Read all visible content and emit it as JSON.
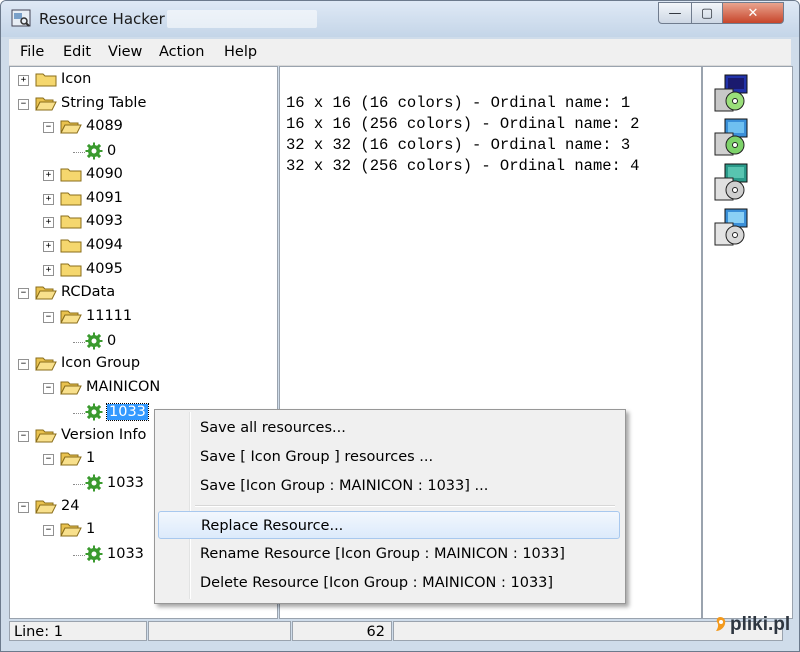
{
  "window": {
    "title": "Resource Hacker",
    "minimize_glyph": "—",
    "maximize_glyph": "▢",
    "close_glyph": "✕"
  },
  "menu": [
    "File",
    "Edit",
    "View",
    "Action",
    "Help"
  ],
  "tree": [
    {
      "label": "Icon",
      "level": 0,
      "expander": "+",
      "icon": "folder-closed-icon"
    },
    {
      "label": "String Table",
      "level": 0,
      "expander": "-",
      "icon": "folder-open-icon"
    },
    {
      "label": "4089",
      "level": 1,
      "expander": "-",
      "icon": "folder-open-icon"
    },
    {
      "label": "0",
      "level": 2,
      "expander": "",
      "icon": "gear-icon"
    },
    {
      "label": "4090",
      "level": 1,
      "expander": "+",
      "icon": "folder-closed-icon"
    },
    {
      "label": "4091",
      "level": 1,
      "expander": "+",
      "icon": "folder-closed-icon"
    },
    {
      "label": "4093",
      "level": 1,
      "expander": "+",
      "icon": "folder-closed-icon"
    },
    {
      "label": "4094",
      "level": 1,
      "expander": "+",
      "icon": "folder-closed-icon"
    },
    {
      "label": "4095",
      "level": 1,
      "expander": "+",
      "icon": "folder-closed-icon"
    },
    {
      "label": "RCData",
      "level": 0,
      "expander": "-",
      "icon": "folder-open-icon"
    },
    {
      "label": "11111",
      "level": 1,
      "expander": "-",
      "icon": "folder-open-icon"
    },
    {
      "label": "0",
      "level": 2,
      "expander": "",
      "icon": "gear-icon"
    },
    {
      "label": "Icon Group",
      "level": 0,
      "expander": "-",
      "icon": "folder-open-icon"
    },
    {
      "label": "MAINICON",
      "level": 1,
      "expander": "-",
      "icon": "folder-open-icon"
    },
    {
      "label": "1033",
      "level": 2,
      "expander": "",
      "icon": "gear-icon",
      "selected": true
    },
    {
      "label": "Version Info",
      "level": 0,
      "expander": "-",
      "icon": "folder-open-icon"
    },
    {
      "label": "1",
      "level": 1,
      "expander": "-",
      "icon": "folder-open-icon"
    },
    {
      "label": "1033",
      "level": 2,
      "expander": "",
      "icon": "gear-icon"
    },
    {
      "label": "24",
      "level": 0,
      "expander": "-",
      "icon": "folder-open-icon"
    },
    {
      "label": "1",
      "level": 1,
      "expander": "-",
      "icon": "folder-open-icon"
    },
    {
      "label": "1033",
      "level": 2,
      "expander": "",
      "icon": "gear-icon"
    }
  ],
  "text_pane": {
    "lines": [
      "16 x 16 (16 colors) - Ordinal name: 1",
      "16 x 16 (256 colors) - Ordinal name: 2",
      "32 x 32 (16 colors) - Ordinal name: 3",
      "32 x 32 (256 colors) - Ordinal name: 4"
    ]
  },
  "icon_pane": {
    "icons": [
      "installer-icon-1",
      "installer-icon-2",
      "installer-icon-3",
      "installer-icon-4"
    ]
  },
  "context_menu": {
    "items": [
      {
        "label": "Save all resources...",
        "highlighted": false
      },
      {
        "label": "Save [ Icon Group ] resources ...",
        "highlighted": false
      },
      {
        "label": "Save [Icon Group : MAINICON : 1033] ...",
        "highlighted": false
      },
      {
        "label": "Replace Resource...",
        "highlighted": true
      },
      {
        "label": "Rename Resource [Icon Group : MAINICON : 1033]",
        "highlighted": false
      },
      {
        "label": "Delete Resource [Icon Group : MAINICON : 1033]",
        "highlighted": false
      }
    ]
  },
  "status_bar": {
    "line": "Line: 1",
    "cell2": "",
    "value": "62",
    "cell4": ""
  },
  "watermark": "pliki.pl",
  "colors": {
    "selection": "#3399ff",
    "folder": "#f5d76e",
    "gear": "#3a9a2e"
  }
}
